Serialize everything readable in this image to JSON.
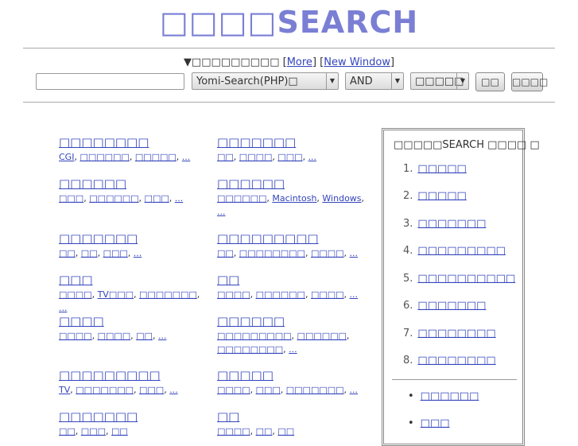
{
  "logo": "□□□□SEARCH",
  "search": {
    "caption_prefix": "▼□□□□□□□□□",
    "more_label": "More",
    "new_window_label": "New Window",
    "input_value": "",
    "engine_select": "Yomi-Search(PHP)□",
    "mode_select": "AND",
    "count_select": "□□□□□",
    "search_button": "□□",
    "options_button": "□□□□"
  },
  "categories_left": [
    {
      "title": "□□□□□□□□",
      "subs": [
        "CGI",
        "□□□□□□",
        "□□□□□",
        "..."
      ]
    },
    {
      "title": "□□□□□□",
      "subs": [
        "□□□",
        "□□□□□□",
        "□□□",
        "..."
      ]
    },
    {
      "title": "□□□□□□□",
      "subs": [
        "□□",
        "□□",
        "□□□",
        "..."
      ]
    },
    {
      "title": "□□□",
      "subs": [
        "□□□□",
        "TV□□□",
        "□□□□□□□",
        "..."
      ]
    },
    {
      "title": "□□□□",
      "subs": [
        "□□□□",
        "□□□□",
        "□□",
        "..."
      ]
    },
    {
      "title": "□□□□□□□□□",
      "subs": [
        "TV",
        "□□□□□□□",
        "□□□",
        "..."
      ]
    },
    {
      "title": "□□□□□□□",
      "subs": [
        "□□",
        "□□□",
        "□□"
      ]
    }
  ],
  "categories_right": [
    {
      "title": "□□□□□□□",
      "subs": [
        "□□",
        "□□□□",
        "□□□",
        "..."
      ]
    },
    {
      "title": "□□□□□□",
      "subs": [
        "□□□□□□",
        "Macintosh",
        "Windows",
        "..."
      ]
    },
    {
      "title": "□□□□□□□□□",
      "subs": [
        "□□",
        "□□□□□□□□",
        "□□□□",
        "..."
      ]
    },
    {
      "title": "□□",
      "subs": [
        "□□□□",
        "□□□□□□",
        "□□□□",
        "..."
      ]
    },
    {
      "title": "□□□□□□",
      "subs": [
        "□□□□□□□□□",
        "□□□□□□",
        "□□□□□□□□",
        "..."
      ]
    },
    {
      "title": "□□□□□",
      "subs": [
        "□□□□",
        "□□□",
        "□□□□□□□",
        "..."
      ]
    },
    {
      "title": "□□",
      "subs": [
        "□□□□",
        "□□",
        "□□"
      ]
    }
  ],
  "ranking": {
    "title": "□□□□□SEARCH □□□□ □",
    "items": [
      {
        "num": "1.",
        "label": "□□□□□"
      },
      {
        "num": "2.",
        "label": "□□□□□"
      },
      {
        "num": "3.",
        "label": "□□□□□□□"
      },
      {
        "num": "4.",
        "label": "□□□□□□□□□"
      },
      {
        "num": "5.",
        "label": "□□□□□□□□□□"
      },
      {
        "num": "6.",
        "label": "□□□□□□□"
      },
      {
        "num": "7.",
        "label": "□□□□□□□□"
      },
      {
        "num": "8.",
        "label": "□□□□□□□□"
      }
    ],
    "links": [
      "□□□□□□",
      "□□□"
    ]
  }
}
